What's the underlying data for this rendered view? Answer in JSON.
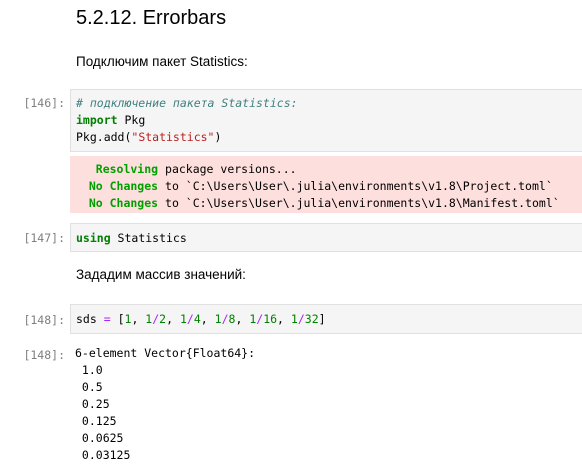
{
  "heading": "5.2.12. Errorbars",
  "markdown": {
    "p1": "Подключим пакет Statistics:",
    "p2": "Зададим массив значений:"
  },
  "cells": {
    "c146": {
      "in_prompt": "[146]:",
      "comment": "# подключение пакета Statistics:",
      "kw_import": "import",
      "import_rest": " Pkg",
      "add_pre": "Pkg.add(",
      "add_str": "\"Statistics\"",
      "add_post": ")"
    },
    "stderr": {
      "l1_label": "   Resolving",
      "l1_rest": " package versions...",
      "l2_label": "  No Changes",
      "l2_rest": " to `C:\\Users\\User\\.julia\\environments\\v1.8\\Project.toml`",
      "l3_label": "  No Changes",
      "l3_rest": " to `C:\\Users\\User\\.julia\\environments\\v1.8\\Manifest.toml`"
    },
    "c147": {
      "in_prompt": "[147]:",
      "kw_using": "using",
      "rest": " Statistics"
    },
    "c148": {
      "in_prompt": "[148]:",
      "out_prompt": "[148]:",
      "var": "sds ",
      "eq": "=",
      "sp": " [",
      "t1": "1",
      "t2": ", ",
      "t3": "1",
      "t4": "/",
      "t5": "2",
      "t6": ", ",
      "t7": "1",
      "t8": "/",
      "t9": "4",
      "t10": ", ",
      "t11": "1",
      "t12": "/",
      "t13": "8",
      "t14": ", ",
      "t15": "1",
      "t16": "/",
      "t17": "16",
      "t18": ", ",
      "t19": "1",
      "t20": "/",
      "t21": "32",
      "t22": "]",
      "output": [
        "6-element Vector{Float64}:",
        " 1.0",
        " 0.5",
        " 0.25",
        " 0.125",
        " 0.0625",
        " 0.03125"
      ]
    }
  }
}
